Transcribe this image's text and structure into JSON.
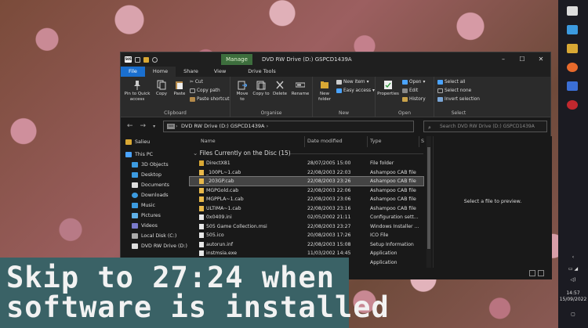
{
  "window": {
    "title": "DVD RW Drive (D:) GSPCD1439A",
    "manage_tab": "Manage",
    "controls": [
      "–",
      "☐",
      "✕"
    ]
  },
  "tabs": [
    "File",
    "Home",
    "Share",
    "View",
    "Drive Tools"
  ],
  "ribbon": {
    "clipboard": {
      "label": "Clipboard",
      "pin": "Pin to Quick access",
      "copy": "Copy",
      "paste": "Paste",
      "cut": "Cut",
      "copy_path": "Copy path",
      "paste_shortcut": "Paste shortcut"
    },
    "organise": {
      "label": "Organise",
      "move_to": "Move to",
      "copy_to": "Copy to",
      "delete": "Delete",
      "rename": "Rename"
    },
    "new": {
      "label": "New",
      "new_folder": "New folder",
      "new_item": "New item",
      "easy_access": "Easy access"
    },
    "open": {
      "label": "Open",
      "properties": "Properties",
      "open": "Open",
      "edit": "Edit",
      "history": "History"
    },
    "select": {
      "label": "Select",
      "select_all": "Select all",
      "select_none": "Select none",
      "invert": "Invert selection"
    }
  },
  "address": {
    "path": "DVD RW Drive (D:) GSPCD1439A",
    "search_placeholder": "Search DVD RW Drive (D:) GSPCD1439A"
  },
  "nav_pane": [
    "Salieu",
    "This PC",
    "3D Objects",
    "Desktop",
    "Documents",
    "Downloads",
    "Music",
    "Pictures",
    "Videos",
    "Local Disk (C:)",
    "DVD RW Drive (D:)"
  ],
  "columns": [
    "Name",
    "Date modified",
    "Type",
    "S"
  ],
  "group_header": "Files Currently on the Disc (15)",
  "files": [
    {
      "name": "DirectX81",
      "date": "28/07/2005 15:00",
      "type": "File folder",
      "kind": "folder"
    },
    {
      "name": "_100PL~1.cab",
      "date": "22/08/2003 22:03",
      "type": "Ashampoo CAB file",
      "kind": "cab"
    },
    {
      "name": "_203GP.cab",
      "date": "22/08/2003 23:26",
      "type": "Ashampoo CAB file",
      "kind": "cab"
    },
    {
      "name": "MGPGold.cab",
      "date": "22/08/2003 22:06",
      "type": "Ashampoo CAB file",
      "kind": "cab"
    },
    {
      "name": "MGPPLA~1.cab",
      "date": "22/08/2003 23:06",
      "type": "Ashampoo CAB file",
      "kind": "cab"
    },
    {
      "name": "ULTIMA~1.cab",
      "date": "22/08/2003 23:16",
      "type": "Ashampoo CAB file",
      "kind": "cab"
    },
    {
      "name": "0x0409.ini",
      "date": "02/05/2002 21:11",
      "type": "Configuration sett...",
      "kind": "doc"
    },
    {
      "name": "505 Game Collection.msi",
      "date": "22/08/2003 23:27",
      "type": "Windows Installer ...",
      "kind": "doc"
    },
    {
      "name": "505.ico",
      "date": "20/08/2003 17:26",
      "type": "ICO File",
      "kind": "doc"
    },
    {
      "name": "autorun.inf",
      "date": "22/08/2003 15:08",
      "type": "Setup Information",
      "kind": "doc"
    },
    {
      "name": "instmsia.exe",
      "date": "11/03/2002 14:45",
      "type": "Application",
      "kind": "doc"
    },
    {
      "name": "",
      "date": "",
      "type": "Application",
      "kind": "doc"
    }
  ],
  "selected_index": 2,
  "preview_text": "Select a file to preview.",
  "taskbar": {
    "time": "14:57",
    "date": "15/09/2022"
  },
  "banner": {
    "line1": "Skip to 27:24 when",
    "line2": "software is installed"
  }
}
